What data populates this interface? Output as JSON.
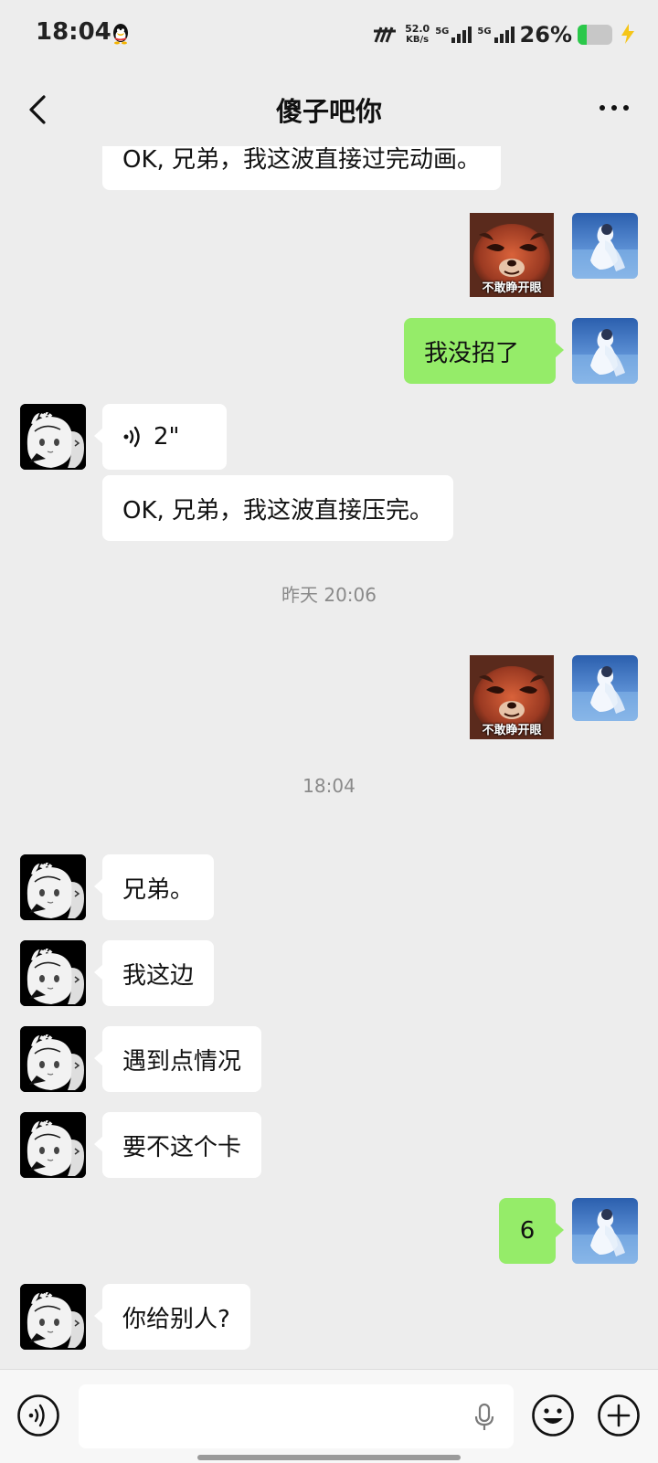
{
  "status_bar": {
    "time": "18:04",
    "net_speed_value": "52.0",
    "net_speed_unit": "KB/s",
    "signal1_label": "5G",
    "signal2_label": "5G",
    "battery_percent": "26%",
    "battery_level": 0.26
  },
  "header": {
    "title": "傻子吧你"
  },
  "messages": {
    "m0": {
      "text": "OK, 兄弟，我这波直接过完动画。"
    },
    "m1": {
      "sticker_caption": "不敢睁开眼"
    },
    "m2": {
      "text": "我没招了"
    },
    "m3": {
      "voice_duration": "2\""
    },
    "m4": {
      "text": "OK, 兄弟，我这波直接压完。"
    },
    "ts1": {
      "text": "昨天 20:06"
    },
    "m5": {
      "sticker_caption": "不敢睁开眼"
    },
    "ts2": {
      "text": "18:04"
    },
    "m6": {
      "text": "兄弟。"
    },
    "m7": {
      "text": "我这边"
    },
    "m8": {
      "text": "遇到点情况"
    },
    "m9": {
      "text": "要不这个卡"
    },
    "m10": {
      "text": "6"
    },
    "m11": {
      "text": "你给别人?"
    }
  },
  "input_bar": {
    "value": "",
    "icons": [
      "voice-icon",
      "mic-icon",
      "emoji-icon",
      "plus-icon"
    ]
  },
  "colors": {
    "background": "#ededed",
    "bubble_sent": "#95ec69",
    "bubble_received": "#ffffff",
    "timestamp": "#8a8a8a"
  }
}
